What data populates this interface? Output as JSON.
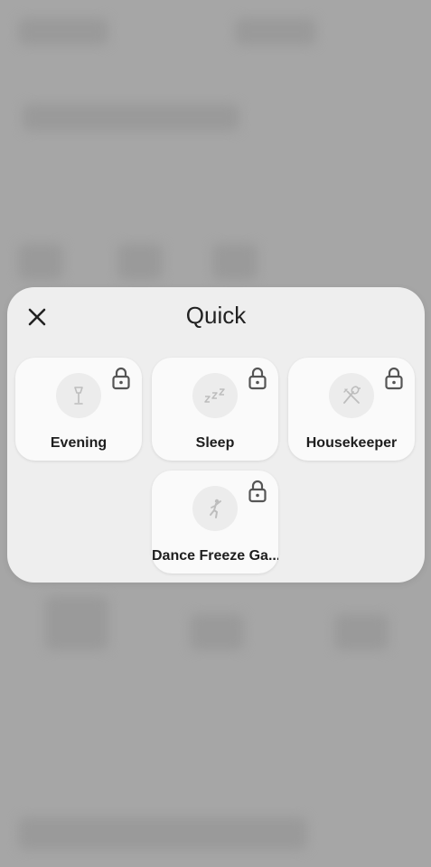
{
  "dialog": {
    "title": "Quick",
    "close_icon": "close-icon"
  },
  "tiles": [
    {
      "label": "Evening",
      "icon": "floor-lamp-icon",
      "locked": true
    },
    {
      "label": "Sleep",
      "icon": "sleep-zzz-icon",
      "locked": true
    },
    {
      "label": "Housekeeper",
      "icon": "cleaning-tools-icon",
      "locked": true
    },
    {
      "label": "Dance Freeze Ga...",
      "icon": "dancing-person-icon",
      "locked": true
    }
  ],
  "colors": {
    "backdrop": "#a6a6a6",
    "panel": "#eeeeee",
    "tile": "#fafafa",
    "icon": "#bdbdbd",
    "lock": "#555555"
  }
}
